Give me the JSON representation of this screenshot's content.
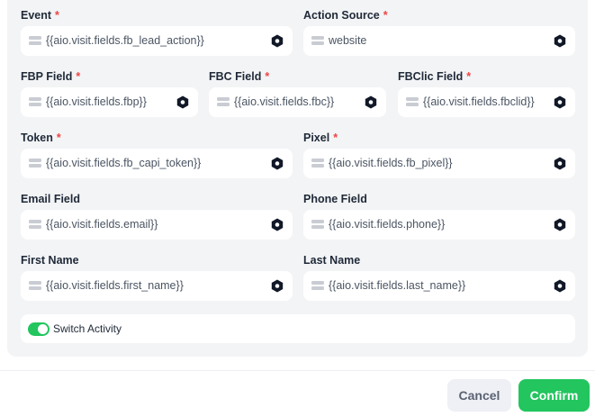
{
  "fields": {
    "event": {
      "label": "Event",
      "required": "*",
      "value": "{{aio.visit.fields.fb_lead_action}}"
    },
    "action_source": {
      "label": "Action Source",
      "required": "*",
      "value": "website"
    },
    "fbp": {
      "label": "FBP Field",
      "required": "*",
      "value": "{{aio.visit.fields.fbp}}"
    },
    "fbc": {
      "label": "FBC Field",
      "required": "*",
      "value": "{{aio.visit.fields.fbc}}"
    },
    "fbclid": {
      "label": "FBClic Field",
      "required": "*",
      "value": "{{aio.visit.fields.fbclid}}"
    },
    "token": {
      "label": "Token",
      "required": "*",
      "value": "{{aio.visit.fields.fb_capi_token}}"
    },
    "pixel": {
      "label": "Pixel",
      "required": "*",
      "value": "{{aio.visit.fields.fb_pixel}}"
    },
    "email": {
      "label": "Email Field",
      "value": "{{aio.visit.fields.email}}"
    },
    "phone": {
      "label": "Phone Field",
      "value": "{{aio.visit.fields.phone}}"
    },
    "first_name": {
      "label": "First Name",
      "value": "{{aio.visit.fields.first_name}}"
    },
    "last_name": {
      "label": "Last Name",
      "value": "{{aio.visit.fields.last_name}}"
    }
  },
  "switch": {
    "label": "Switch Activity",
    "on": true
  },
  "footer": {
    "cancel_label": "Cancel",
    "confirm_label": "Confirm"
  },
  "colors": {
    "accent": "#22c55e",
    "required": "#ef4444",
    "panel": "#f3f4f6"
  }
}
